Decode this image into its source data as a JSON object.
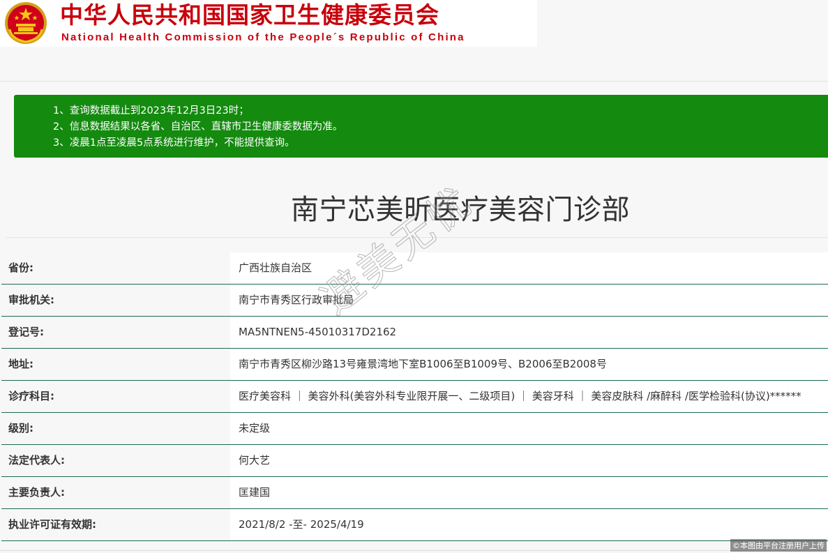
{
  "header": {
    "title_cn": "中华人民共和国国家卫生健康委员会",
    "title_en": "National Health Commission of the People´s Republic of China",
    "brand_color": "#c8000b"
  },
  "notice": {
    "background": "#148a0f",
    "lines": [
      "1、查询数据截止到2023年12月3日23时；",
      "2、信息数据结果以各省、自治区、直辖市卫生健康委数据为准。",
      "3、凌晨1点至凌晨5点系统进行维护，不能提供查询。"
    ]
  },
  "page_title": "南宁芯美昕医疗美容门诊部",
  "rows": [
    {
      "label": "省份:",
      "value": "广西壮族自治区"
    },
    {
      "label": "审批机关:",
      "value": "南宁市青秀区行政审批局"
    },
    {
      "label": "登记号:",
      "value": "MA5NTNEN5-45010317D2162"
    },
    {
      "label": "地址:",
      "value": "南宁市青秀区柳沙路13号雍景湾地下室B1006至B1009号、B2006至B2008号"
    },
    {
      "label": "诊疗科目:",
      "value": "医疗美容科 ｜ 美容外科(美容外科专业限开展一、二级项目) ｜ 美容牙科 ｜ 美容皮肤科 /麻醉科 /医学检验科(协议)******"
    },
    {
      "label": "级别:",
      "value": "未定级"
    },
    {
      "label": "法定代表人:",
      "value": "何大艺"
    },
    {
      "label": "主要负责人:",
      "value": "匡建国"
    },
    {
      "label": "执业许可证有效期:",
      "value": "2021/8/2 -至- 2025/4/19"
    }
  ],
  "watermark": "避美无忧",
  "credit": "©本图由平台注册用户上传"
}
